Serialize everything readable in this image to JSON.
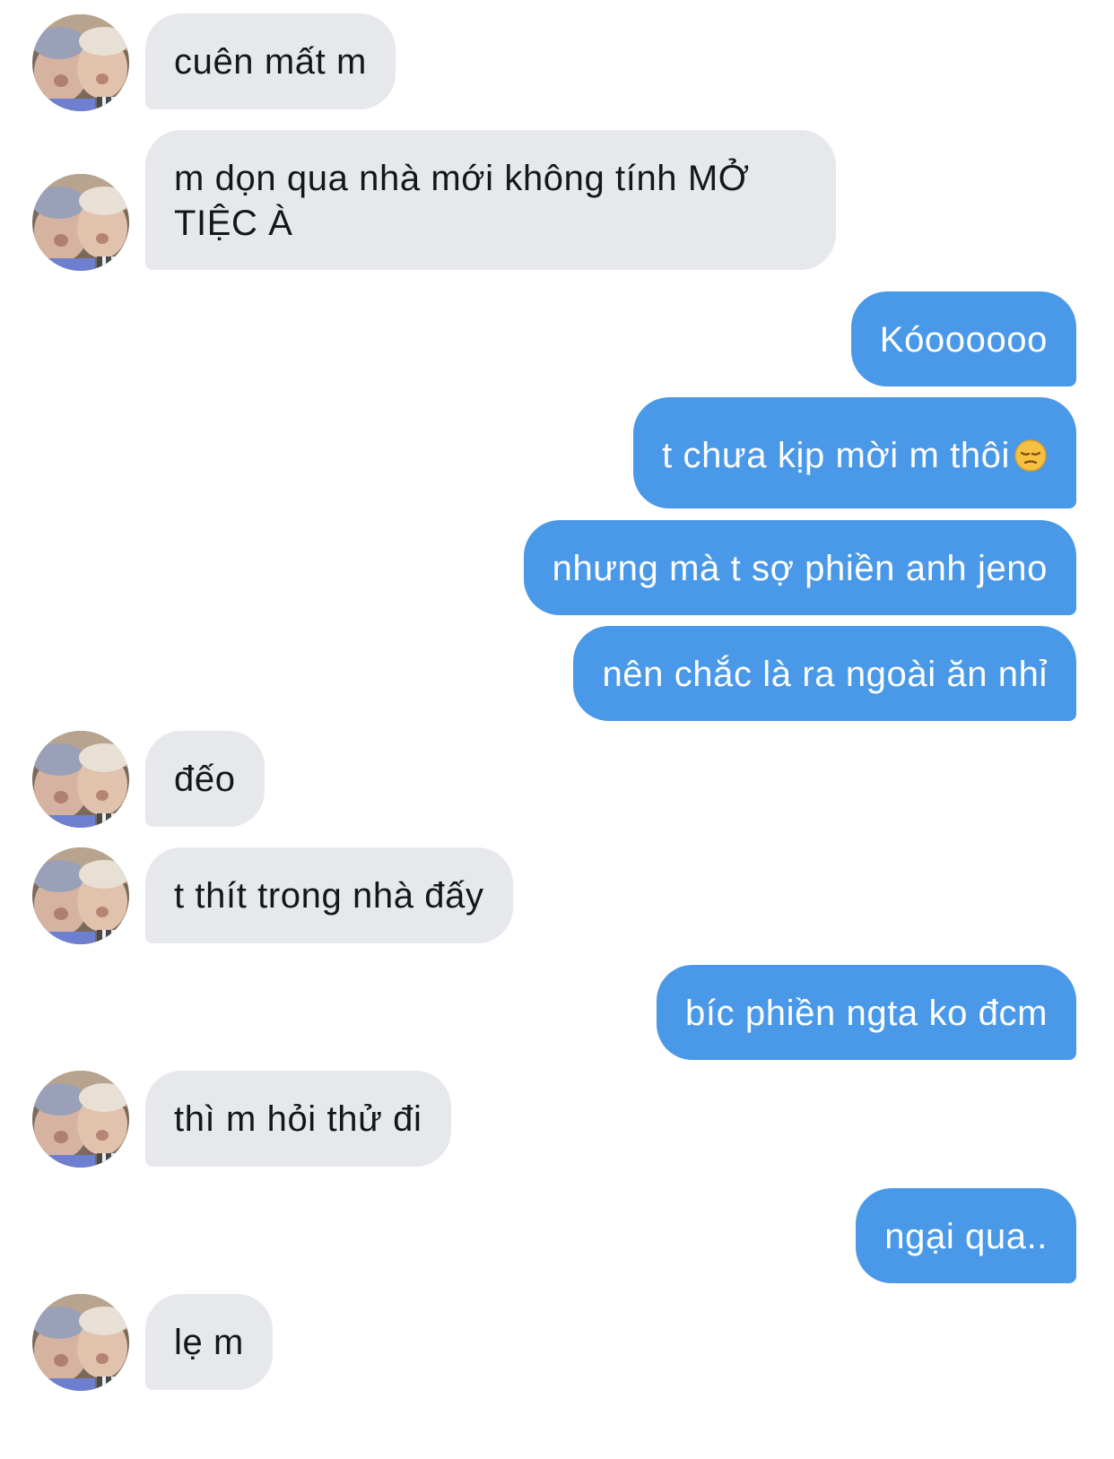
{
  "conversation": {
    "messages": [
      {
        "side": "in",
        "text": "cuên mất m"
      },
      {
        "side": "in",
        "text": "m dọn qua nhà mới không tính MỞ TIỆC À"
      },
      {
        "side": "out",
        "text": "Kóoooooo"
      },
      {
        "side": "out",
        "text": "t chưa kịp mời m thôi",
        "emoji": "pensive-face-icon"
      },
      {
        "side": "out",
        "text": "nhưng mà t sợ phiền anh jeno"
      },
      {
        "side": "out",
        "text": "nên chắc là ra ngoài ăn nhỉ"
      },
      {
        "side": "in",
        "text": "đếo"
      },
      {
        "side": "in",
        "text": "t thít trong nhà đấy"
      },
      {
        "side": "out",
        "text": "bíc phiền ngta ko đcm"
      },
      {
        "side": "in",
        "text": "thì m hỏi thử đi"
      },
      {
        "side": "out",
        "text": "ngại qua.."
      },
      {
        "side": "in",
        "text": "lẹ m"
      }
    ]
  },
  "colors": {
    "incoming_bubble": "#e6e8ec",
    "outgoing_bubble": "#4a99e9",
    "incoming_text": "#14171a",
    "outgoing_text": "#ffffff"
  }
}
